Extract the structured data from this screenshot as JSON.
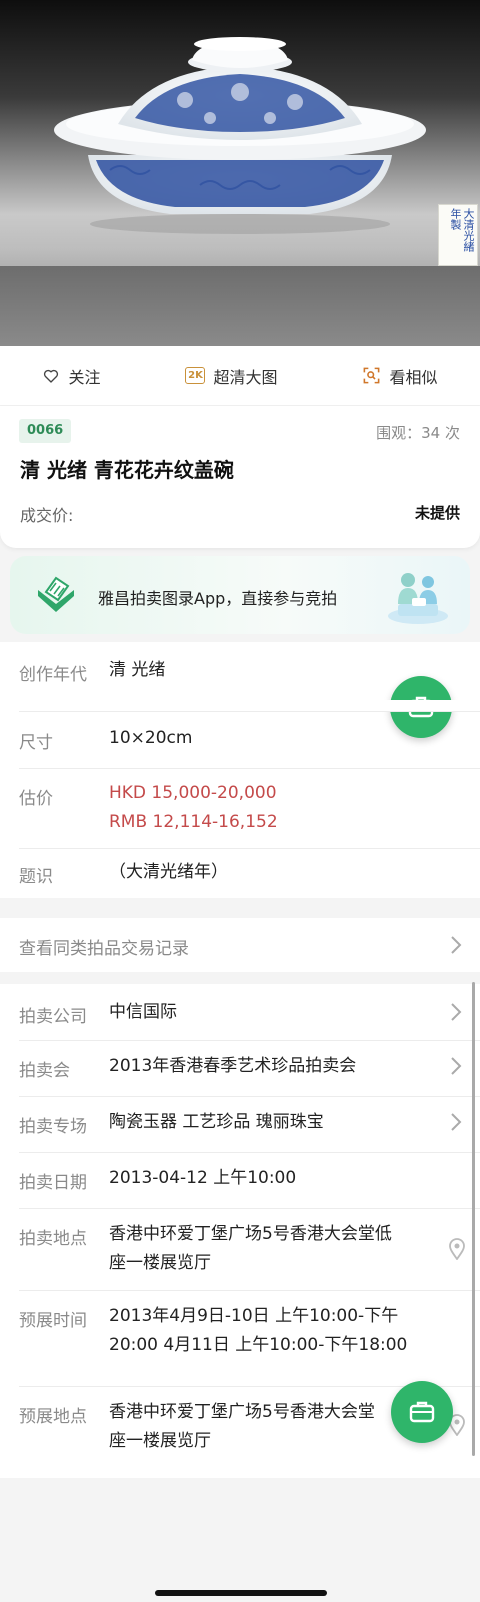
{
  "seal": {
    "text": "大清光緒年製"
  },
  "actions": {
    "follow": "关注",
    "hd_badge": "2K",
    "hd": "超清大图",
    "similar": "看相似"
  },
  "lot": {
    "number": "0066",
    "views": "围观：34 次",
    "title": "清 光绪 青花花卉纹盖碗",
    "price_label": "成交价:",
    "price_value": "未提供"
  },
  "banner": {
    "text": "雅昌拍卖图录App，直接参与竞拍"
  },
  "details": {
    "era_label": "创作年代",
    "era_value": "清 光绪",
    "size_label": "尺寸",
    "size_value": "10×20cm",
    "estimate_label": "估价",
    "estimate_hkd": "HKD  15,000-20,000",
    "estimate_rmb": "RMB 12,114-16,152",
    "inscription_label": "题识",
    "inscription_value": "（大清光绪年）"
  },
  "records_link": "查看同类拍品交易记录",
  "auction": {
    "company_label": "拍卖公司",
    "company_value": "中信国际",
    "sale_label": "拍卖会",
    "sale_value": "2013年香港春季艺术珍品拍卖会",
    "session_label": "拍卖专场",
    "session_value": "陶瓷玉器 工艺珍品 瑰丽珠宝",
    "date_label": "拍卖日期",
    "date_value": "2013-04-12 上午10:00",
    "venue_label": "拍卖地点",
    "venue_line1": "香港中环爱丁堡广场5号香港大会堂低",
    "venue_line2": "座一楼展览厅",
    "preview_time_label": "预展时间",
    "preview_time_line1": "2013年4月9日-10日 上午10:00-下午",
    "preview_time_line2": "20:00 4月11日 上午10:00-下午18:00",
    "preview_venue_label": "预展地点",
    "preview_venue_line1": "香港中环爱丁堡广场5号香港大会堂",
    "preview_venue_line2": "座一楼展览厅"
  },
  "colors": {
    "accent": "#2fb56a",
    "estimate": "#c44a4a",
    "badge": "#2e8b57"
  }
}
